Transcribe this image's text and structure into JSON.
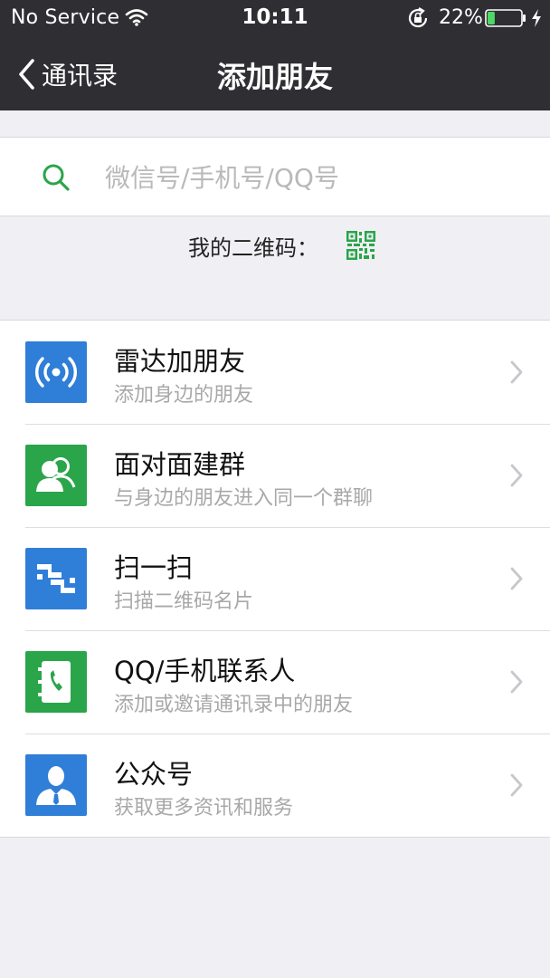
{
  "status_bar": {
    "carrier": "No Service",
    "time": "10:11",
    "battery_percent": "22%",
    "battery_level": 0.22,
    "icons": [
      "wifi-icon",
      "rotation-lock-icon",
      "battery-icon",
      "charging-bolt-icon"
    ]
  },
  "nav": {
    "back_label": "通讯录",
    "title": "添加朋友"
  },
  "search": {
    "placeholder": "微信号/手机号/QQ号",
    "value": ""
  },
  "qr": {
    "label": "我的二维码："
  },
  "items": [
    {
      "title": "雷达加朋友",
      "subtitle": "添加身边的朋友",
      "icon": "radar-icon",
      "color": "#2f7ed8"
    },
    {
      "title": "面对面建群",
      "subtitle": "与身边的朋友进入同一个群聊",
      "icon": "group-icon",
      "color": "#2aa54a"
    },
    {
      "title": "扫一扫",
      "subtitle": "扫描二维码名片",
      "icon": "scan-icon",
      "color": "#2f7ed8"
    },
    {
      "title": "QQ/手机联系人",
      "subtitle": "添加或邀请通讯录中的朋友",
      "icon": "contacts-book-icon",
      "color": "#2aa54a"
    },
    {
      "title": "公众号",
      "subtitle": "获取更多资讯和服务",
      "icon": "official-account-icon",
      "color": "#2f7ed8"
    }
  ],
  "colors": {
    "header_bg": "#2f2e33",
    "page_bg": "#efeff4",
    "accent_green": "#2aa54a",
    "accent_blue": "#2f7ed8"
  }
}
